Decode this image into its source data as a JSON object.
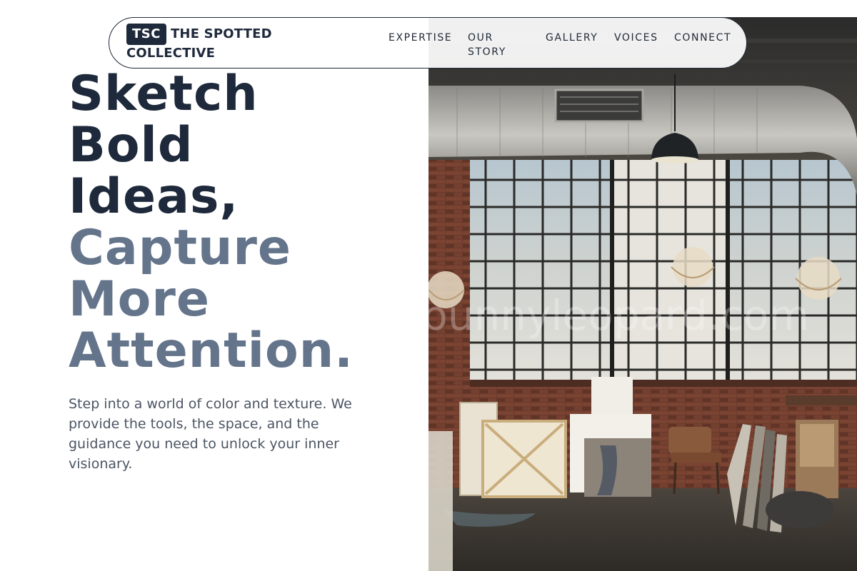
{
  "brand": {
    "badge": "TSC",
    "name_line1": "THE SPOTTED",
    "name_line2": "COLLECTIVE"
  },
  "nav": {
    "items": [
      {
        "label": "EXPERTISE"
      },
      {
        "label": "OUR STORY"
      },
      {
        "label": "GALLERY"
      },
      {
        "label": "VOICES"
      },
      {
        "label": "CONNECT"
      }
    ]
  },
  "hero": {
    "headline_dark": [
      "Sketch",
      "Bold",
      "Ideas,"
    ],
    "headline_muted": [
      "Capture",
      "More",
      "Attention."
    ],
    "intro": "Step into a world of color and texture. We provide the tools, the space, and the guidance you need to unlock your inner visionary.",
    "image_watermark": "bunnyleopard.com"
  },
  "colors": {
    "primary_dark": "#1e293b",
    "headline_muted": "#64748b",
    "body_text": "#4b5563"
  },
  "icons": {
    "brand_logo": "tsc-badge",
    "hero_image": "art-studio-loft-photo"
  }
}
